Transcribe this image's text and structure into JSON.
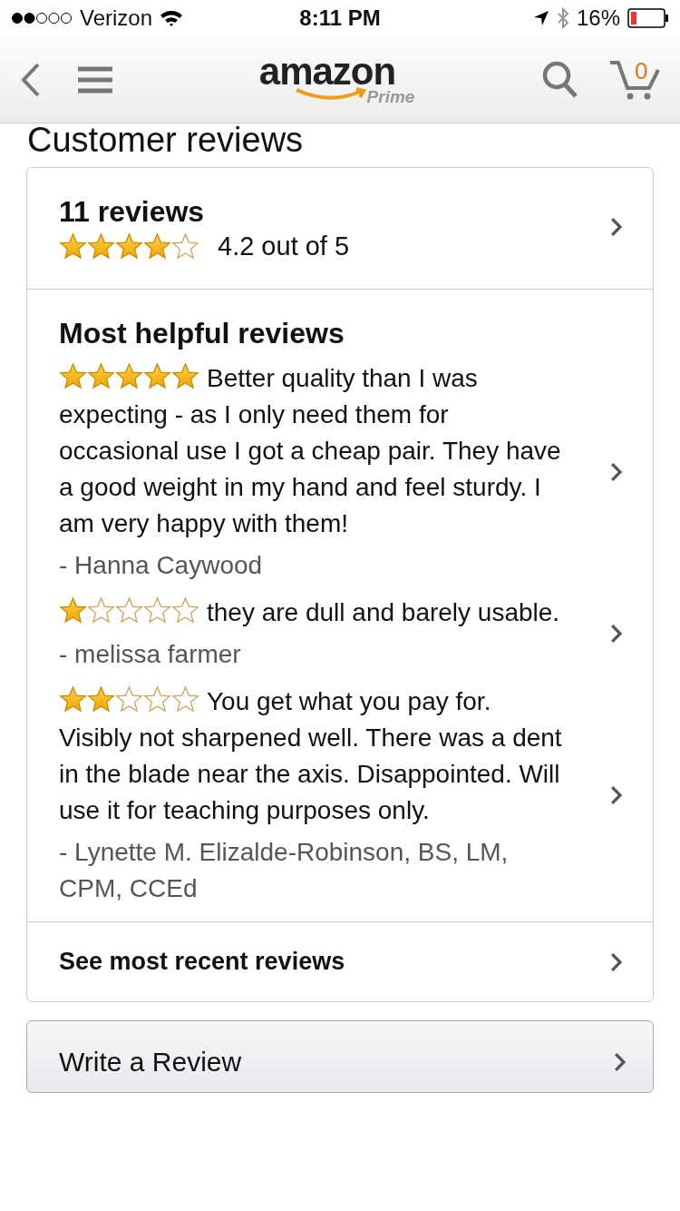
{
  "status_bar": {
    "carrier": "Verizon",
    "time": "8:11 PM",
    "battery": "16%"
  },
  "nav": {
    "logo": "amazon",
    "logo_tag": "Prime",
    "cart_count": "0"
  },
  "title": "Customer reviews",
  "summary": {
    "count": "11 reviews",
    "stars": 4,
    "rating": "4.2 out of 5"
  },
  "helpful": {
    "heading": "Most helpful reviews",
    "reviews": [
      {
        "stars": 5,
        "text": "Better quality than I was expecting - as I only need them for occasional use I got a cheap pair. They have a good weight in my hand and feel sturdy. I am very happy with them!",
        "author": "- Hanna Caywood"
      },
      {
        "stars": 1,
        "text": "they are dull and barely usable.",
        "author": "- melissa farmer"
      },
      {
        "stars": 2,
        "text": "You get what you pay for. Visibly not sharpened well. There was a dent in the blade near the axis. Disappointed. Will use it for teaching purposes only.",
        "author": "- Lynette M. Elizalde-Robinson, BS, LM, CPM, CCEd"
      }
    ]
  },
  "recent_link": "See most recent reviews",
  "write_button": "Write a Review"
}
